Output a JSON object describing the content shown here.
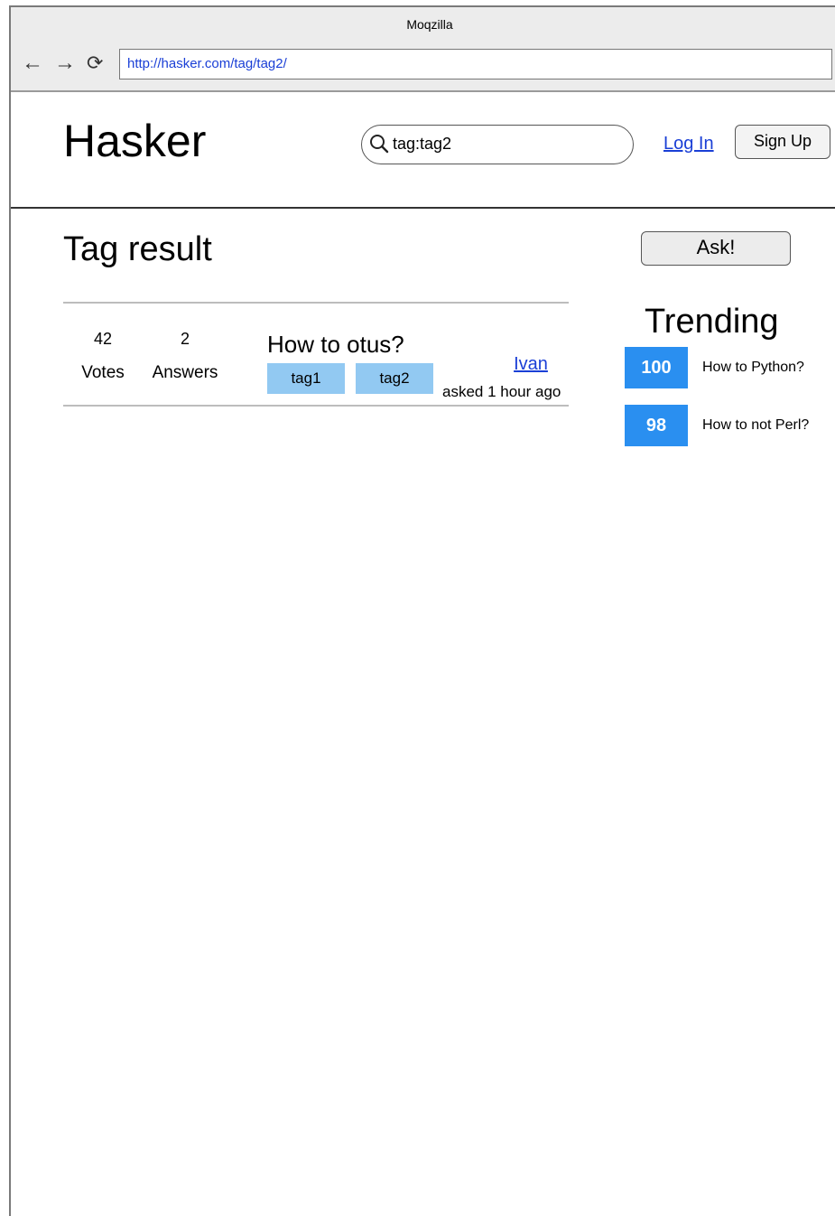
{
  "browser": {
    "window_title": "Moqzilla",
    "url": "http://hasker.com/tag/tag2/",
    "back_icon": "←",
    "forward_icon": "→",
    "reload_icon": "⟳"
  },
  "header": {
    "logo": "Hasker",
    "search_value": "tag:tag2",
    "login_label": "Log In",
    "signup_label": "Sign Up"
  },
  "main": {
    "title": "Tag result",
    "questions": [
      {
        "votes": "42",
        "votes_label": "Votes",
        "answers": "2",
        "answers_label": "Answers",
        "title": "How to otus?",
        "tags": [
          "tag1",
          "tag2"
        ],
        "author": "Ivan",
        "asked": "asked 1 hour ago"
      }
    ]
  },
  "sidebar": {
    "ask_label": "Ask!",
    "trending_title": "Trending",
    "trending": [
      {
        "score": "100",
        "title": "How to Python?"
      },
      {
        "score": "98",
        "title": "How to not Perl?"
      }
    ]
  },
  "colors": {
    "link": "#1a3fd6",
    "tag_bg": "#92c9f2",
    "score_bg": "#2a8ff0"
  }
}
